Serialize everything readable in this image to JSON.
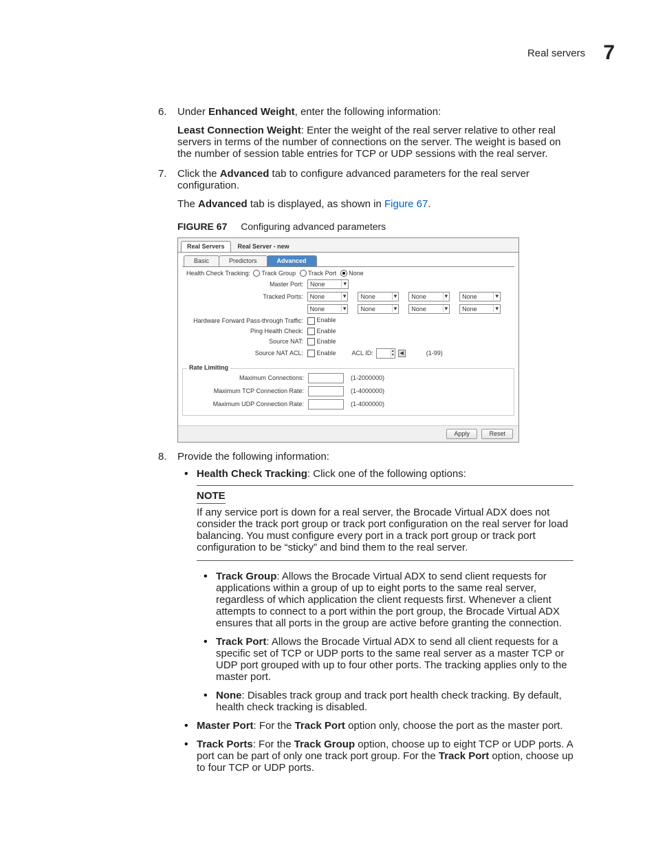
{
  "header": {
    "section": "Real servers",
    "chapnum": "7"
  },
  "steps": {
    "s6": {
      "num": "6.",
      "intro_pre": "Under ",
      "intro_bold": "Enhanced Weight",
      "intro_post": ", enter the following information:",
      "sub_bold": "Least Connection Weight",
      "sub_text": ": Enter the weight of the real server relative to other real servers in terms of the number of connections on the server. The weight is based on the number of session table entries for TCP or UDP sessions with the real server."
    },
    "s7": {
      "num": "7.",
      "line1_pre": "Click the ",
      "line1_bold": "Advanced",
      "line1_post": " tab to configure advanced parameters for the real server configuration.",
      "line2_pre": "The ",
      "line2_bold": "Advanced",
      "line2_mid": " tab is displayed, as shown in ",
      "line2_link": "Figure 67",
      "line2_end": "."
    },
    "s8": {
      "num": "8.",
      "intro": "Provide the following information:"
    }
  },
  "figcap": {
    "num": "FIGURE 67",
    "title": "Configuring advanced parameters"
  },
  "figure": {
    "tab_main": "Real Servers",
    "crumb": "Real Server - new",
    "subtabs": {
      "basic": "Basic",
      "predictors": "Predictors",
      "advanced": "Advanced"
    },
    "labels": {
      "hct": "Health Check Tracking:",
      "master": "Master Port:",
      "tracked": "Tracked Ports:",
      "hwfwd": "Hardware Forward Pass-through Traffic:",
      "ping": "Ping Health Check:",
      "snat": "Source NAT:",
      "snatacl": "Source NAT ACL:",
      "aclid": "ACL ID:",
      "enable": "Enable",
      "rate_legend": "Rate Limiting",
      "maxconn": "Maximum Connections:",
      "maxtcp": "Maximum TCP Connection Rate:",
      "maxudp": "Maximum UDP Connection Rate:"
    },
    "radios": {
      "trackgroup": "Track Group",
      "trackport": "Track Port",
      "none": "None"
    },
    "dropdown_none": "None",
    "ranges": {
      "acl": "(1-99)",
      "conn": "(1-2000000)",
      "tcp": "(1-4000000)",
      "udp": "(1-4000000)"
    },
    "buttons": {
      "apply": "Apply",
      "reset": "Reset"
    }
  },
  "s8_items": {
    "hct_head": "Health Check Tracking",
    "hct_tail": ": Click one of the following options:",
    "note_title": "NOTE",
    "note_body": "If any service port is down for a real server, the Brocade Virtual ADX does not consider the track port group or track port configuration on the real server for load balancing. You must configure every port in a track port group or track port configuration to be “sticky” and bind them to the real server.",
    "tg_head": "Track Group",
    "tg_body": ": Allows the Brocade Virtual ADX to send client requests for applications within a group of up to eight ports to the same real server, regardless of which application the client requests first. Whenever a client attempts to connect to a port within the port group, the Brocade Virtual ADX ensures that all ports in the group are active before granting the connection.",
    "tp_head": "Track Port",
    "tp_body": ": Allows the Brocade Virtual ADX to send all client requests for a specific set of TCP or UDP ports to the same real server as a master TCP or UDP port grouped with up to four other ports. The tracking applies only to the master port.",
    "none_head": "None",
    "none_body": ": Disables track group and track port health check tracking. By default, health check tracking is disabled.",
    "master_head": "Master Port",
    "master_mid": ": For the ",
    "master_bold2": "Track Port",
    "master_tail": " option only, choose the port as the master port.",
    "tports_head": "Track Ports",
    "tports_mid": ": For the ",
    "tports_bold2": "Track Group",
    "tports_mid2": " option, choose up to eight TCP or UDP ports. A port can be part of only one track port group. For the ",
    "tports_bold3": "Track Port",
    "tports_tail": " option, choose up to four TCP or UDP ports."
  }
}
